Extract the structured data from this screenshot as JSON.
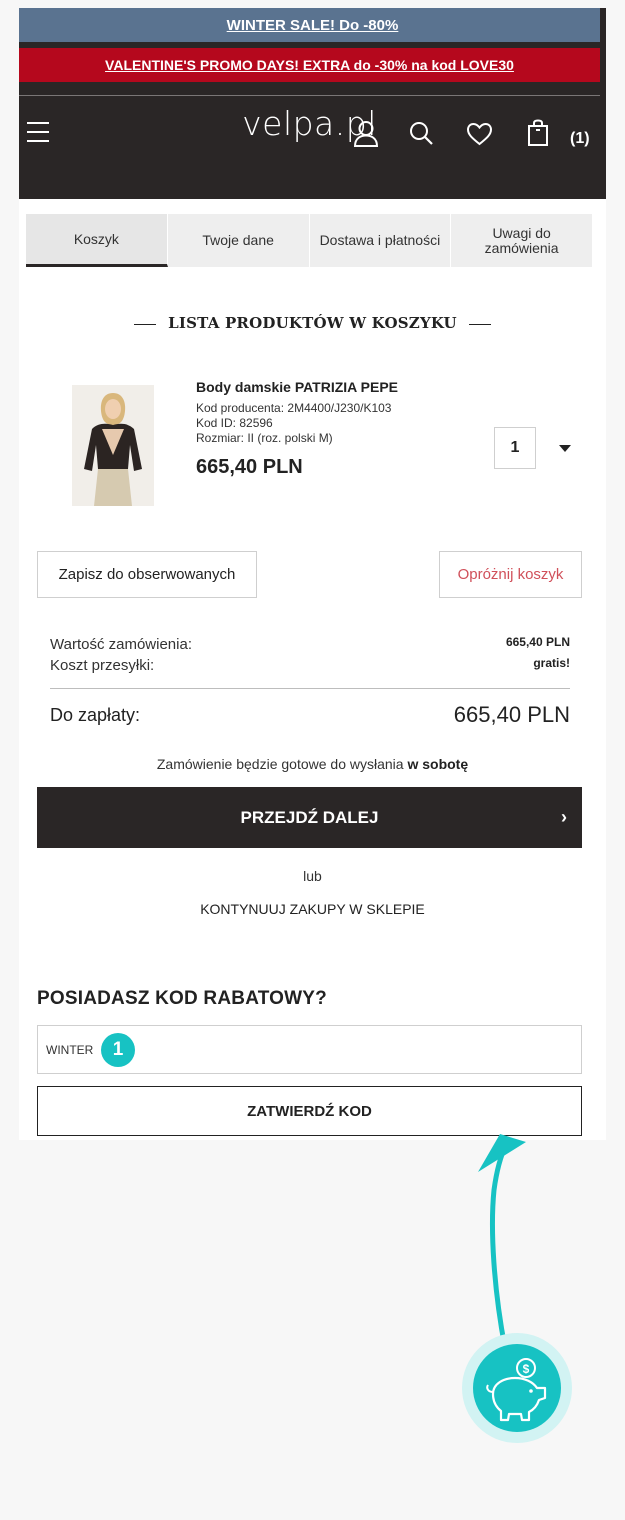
{
  "promo": {
    "winter_sale": "WINTER SALE! Do -80%",
    "valentine": "VALENTINE'S PROMO DAYS! EXTRA do -30% na kod LOVE30"
  },
  "header": {
    "logo": "velpa.pl",
    "cart_count": "(1)"
  },
  "tabs": [
    {
      "label": "Koszyk",
      "active": true
    },
    {
      "label": "Twoje dane",
      "active": false
    },
    {
      "label": "Dostawa i płatności",
      "active": false
    },
    {
      "label": "Uwagi do zamówienia",
      "active": false
    }
  ],
  "section_title": "LISTA PRODUKTÓW W KOSZYKU",
  "product": {
    "name": "Body damskie PATRIZIA PEPE",
    "producer_code": "Kod producenta: 2M4400/J230/K103",
    "id_code": "Kod ID: 82596",
    "size": "Rozmiar: II (roz. polski M)",
    "price": "665,40 PLN",
    "quantity": "1"
  },
  "actions": {
    "save": "Zapisz do obserwowanych",
    "empty": "Opróżnij koszyk"
  },
  "summary": {
    "order_value_label": "Wartość zamówienia:",
    "order_value": "665,40 PLN",
    "shipping_label": "Koszt przesyłki:",
    "shipping": "gratis!",
    "to_pay_label": "Do zapłaty:",
    "to_pay": "665,40 PLN"
  },
  "ready": {
    "text": "Zamówienie będzie gotowe do wysłania ",
    "day": "w sobotę"
  },
  "proceed": {
    "label": "PRZEJDŹ DALEJ",
    "chevron": "›"
  },
  "or_text": "lub",
  "continue_label": "KONTYNUUJ ZAKUPY W SKLEPIE",
  "discount": {
    "title": "POSIADASZ KOD RABATOWY?",
    "input_value": "WINTER",
    "badge": "1",
    "submit": "ZATWIERDŹ KOD"
  },
  "colors": {
    "accent": "#17c2c3",
    "header_bg": "#2a2626",
    "winter_bar": "#5a7390",
    "valentine_bar": "#b5081d",
    "empty_cart_text": "#d0505a"
  },
  "icons": [
    "menu-icon",
    "user-icon",
    "search-icon",
    "heart-icon",
    "bag-icon",
    "chevron-right-icon",
    "piggy-bank-icon",
    "arrow-up-icon"
  ]
}
